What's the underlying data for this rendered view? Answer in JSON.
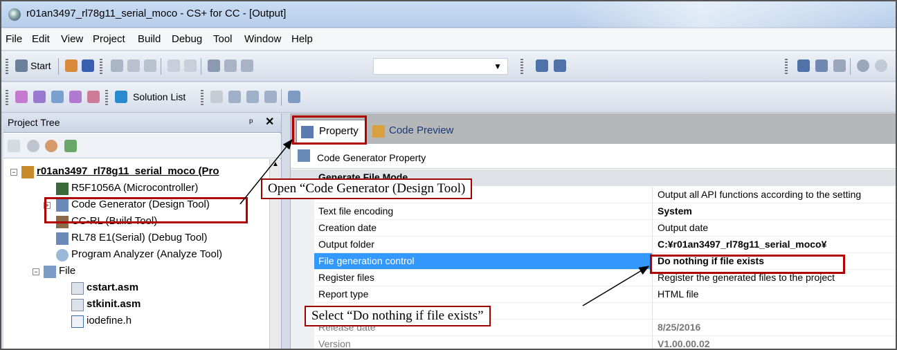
{
  "window": {
    "title": "r01an3497_rl78g11_serial_moco - CS+ for CC - [Output]"
  },
  "menu": [
    "File",
    "Edit",
    "View",
    "Project",
    "Build",
    "Debug",
    "Tool",
    "Window",
    "Help"
  ],
  "toolbar1": {
    "start_label": "Start"
  },
  "toolbar2": {
    "solution_list_label": "Solution List"
  },
  "project_tree": {
    "title": "Project Tree",
    "pin": "↕",
    "close": "✕",
    "items": [
      {
        "label": "r01an3497_rl78g11_serial_moco (Pro",
        "bold": true
      },
      {
        "label": "R5F1056A (Microcontroller)"
      },
      {
        "label": "Code Generator (Design Tool)"
      },
      {
        "label": "CC-RL (Build Tool)"
      },
      {
        "label": "RL78 E1(Serial) (Debug Tool)"
      },
      {
        "label": "Program Analyzer (Analyze Tool)"
      },
      {
        "label": "File"
      },
      {
        "label": "cstart.asm",
        "bold": true
      },
      {
        "label": "stkinit.asm",
        "bold": true
      },
      {
        "label": "iodefine.h"
      }
    ]
  },
  "tabs": [
    {
      "label": "Property",
      "active": true
    },
    {
      "label": "Code Preview",
      "active": false
    }
  ],
  "property": {
    "header": "Code Generator Property",
    "category": "Generate File Mode",
    "rows": [
      {
        "name": "",
        "value": "Output all API functions according to the setting"
      },
      {
        "name": "Text file encoding",
        "value": "System",
        "bold": true
      },
      {
        "name": "Creation date",
        "value": "Output date"
      },
      {
        "name": "Output folder",
        "value": "C:¥r01an3497_rl78g11_serial_moco¥",
        "bold": true
      },
      {
        "name": "File generation control",
        "value": "Do nothing if file exists",
        "bold": true,
        "selected": true
      },
      {
        "name": "Register files",
        "value": "Register the generated files to the project"
      },
      {
        "name": "Report type",
        "value": "HTML file"
      },
      {
        "name": "",
        "value": ""
      },
      {
        "name": "Release date",
        "value": "8/25/2016",
        "bold": true,
        "grey": true
      },
      {
        "name": "Version",
        "value": "V1.00.00.02",
        "bold": true,
        "grey": true
      }
    ]
  },
  "callouts": {
    "open": "Open “Code Generator (Design Tool)",
    "select": "Select “Do nothing if file exists”"
  },
  "colors": {
    "highlight": "#b00000",
    "selection": "#3399ff"
  }
}
